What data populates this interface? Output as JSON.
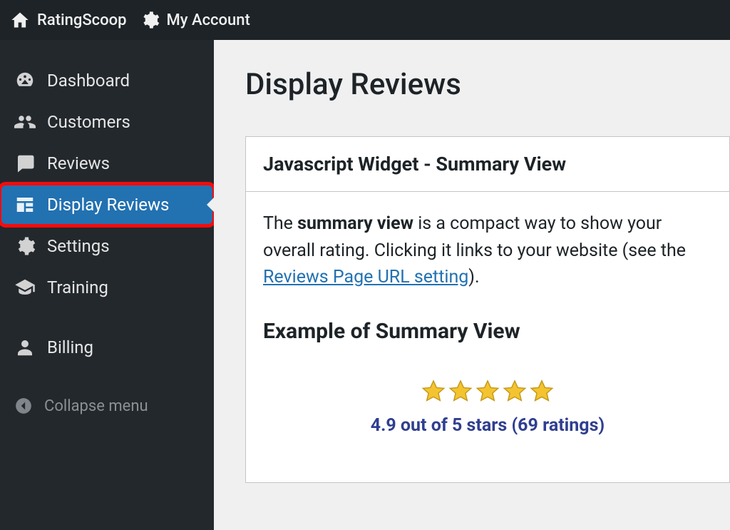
{
  "topbar": {
    "site_name": "RatingScoop",
    "account_label": "My Account"
  },
  "sidebar": {
    "items": [
      {
        "label": "Dashboard"
      },
      {
        "label": "Customers"
      },
      {
        "label": "Reviews"
      },
      {
        "label": "Display Reviews"
      },
      {
        "label": "Settings"
      },
      {
        "label": "Training"
      },
      {
        "label": "Billing"
      }
    ],
    "collapse_label": "Collapse menu"
  },
  "page": {
    "title": "Display Reviews",
    "card_title": "Javascript Widget - Summary View",
    "desc_prefix": "The ",
    "desc_bold": "summary view",
    "desc_mid": " is a compact way to show your overall rating. Clicking it links to your website (see the ",
    "desc_link": "Reviews Page URL setting",
    "desc_suffix": ").",
    "example_heading": "Example of Summary View",
    "rating_text": "4.9 out of 5 stars (69 ratings)"
  }
}
